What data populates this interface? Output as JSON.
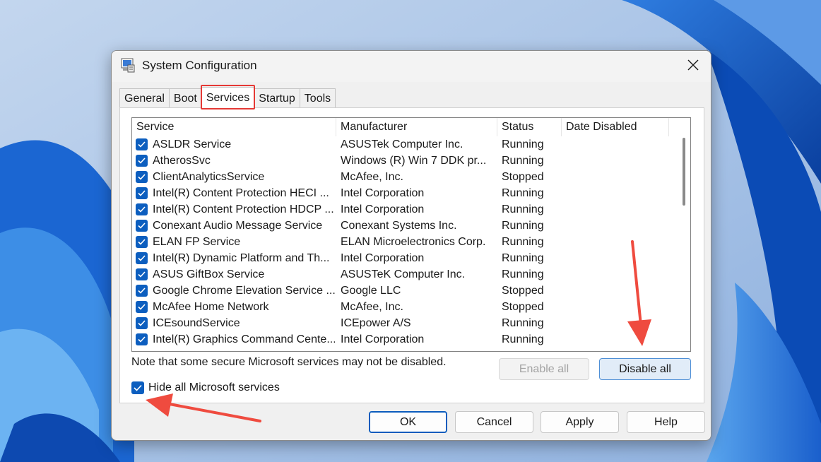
{
  "window": {
    "title": "System Configuration",
    "icon": "msconfig-icon",
    "close_icon": "close-icon"
  },
  "tabs": [
    {
      "label": "General",
      "active": false
    },
    {
      "label": "Boot",
      "active": false
    },
    {
      "label": "Services",
      "active": true
    },
    {
      "label": "Startup",
      "active": false
    },
    {
      "label": "Tools",
      "active": false
    }
  ],
  "services_table": {
    "columns": [
      "Service",
      "Manufacturer",
      "Status",
      "Date Disabled"
    ],
    "rows": [
      {
        "service": "ASLDR Service",
        "manufacturer": "ASUSTek Computer Inc.",
        "status": "Running",
        "date_disabled": "",
        "checked": true
      },
      {
        "service": "AtherosSvc",
        "manufacturer": "Windows (R) Win 7 DDK pr...",
        "status": "Running",
        "date_disabled": "",
        "checked": true
      },
      {
        "service": "ClientAnalyticsService",
        "manufacturer": "McAfee, Inc.",
        "status": "Stopped",
        "date_disabled": "",
        "checked": true
      },
      {
        "service": "Intel(R) Content Protection HECI ...",
        "manufacturer": "Intel Corporation",
        "status": "Running",
        "date_disabled": "",
        "checked": true
      },
      {
        "service": "Intel(R) Content Protection HDCP ...",
        "manufacturer": "Intel Corporation",
        "status": "Running",
        "date_disabled": "",
        "checked": true
      },
      {
        "service": "Conexant Audio Message Service",
        "manufacturer": "Conexant Systems Inc.",
        "status": "Running",
        "date_disabled": "",
        "checked": true
      },
      {
        "service": "ELAN FP Service",
        "manufacturer": "ELAN Microelectronics Corp.",
        "status": "Running",
        "date_disabled": "",
        "checked": true
      },
      {
        "service": "Intel(R) Dynamic Platform and Th...",
        "manufacturer": "Intel Corporation",
        "status": "Running",
        "date_disabled": "",
        "checked": true
      },
      {
        "service": "ASUS GiftBox Service",
        "manufacturer": "ASUSTeK Computer Inc.",
        "status": "Running",
        "date_disabled": "",
        "checked": true
      },
      {
        "service": "Google Chrome Elevation Service ...",
        "manufacturer": "Google LLC",
        "status": "Stopped",
        "date_disabled": "",
        "checked": true
      },
      {
        "service": "McAfee Home Network",
        "manufacturer": "McAfee, Inc.",
        "status": "Stopped",
        "date_disabled": "",
        "checked": true
      },
      {
        "service": "ICEsoundService",
        "manufacturer": "ICEpower A/S",
        "status": "Running",
        "date_disabled": "",
        "checked": true
      },
      {
        "service": "Intel(R) Graphics Command Cente...",
        "manufacturer": "Intel Corporation",
        "status": "Running",
        "date_disabled": "",
        "checked": true
      }
    ]
  },
  "note": "Note that some secure Microsoft services may not be disabled.",
  "buttons": {
    "enable_all": "Enable all",
    "disable_all": "Disable all",
    "ok": "OK",
    "cancel": "Cancel",
    "apply": "Apply",
    "help": "Help"
  },
  "hide_ms": {
    "label": "Hide all Microsoft services",
    "checked": true
  },
  "colors": {
    "accent": "#0c5ebf",
    "highlight": "#e53935",
    "disable_all_bg": "#e1ecf8"
  }
}
